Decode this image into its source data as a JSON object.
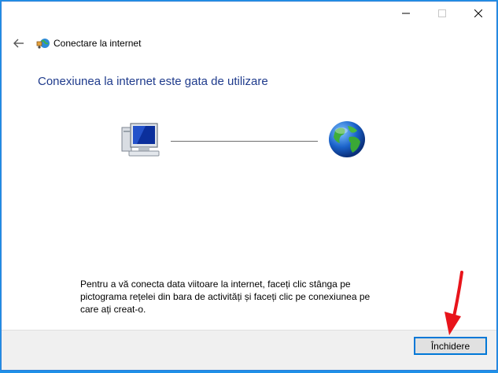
{
  "window": {
    "title_bar_buttons": {
      "minimize_icon": "minimize-icon",
      "maximize_icon": "maximize-icon",
      "close_icon": "close-icon"
    }
  },
  "nav": {
    "back_icon": "back-arrow-icon",
    "app_icon": "network-connection-icon",
    "title": "Conectare la internet"
  },
  "main": {
    "heading": "Conexiunea la internet este gata de utilizare",
    "diagram": {
      "left_icon": "computer-icon",
      "right_icon": "globe-icon"
    },
    "instructions": "Pentru a vă conecta data viitoare la internet, faceți clic stânga pe pictograma rețelei din bara de activități și faceți clic pe conexiunea pe care ați creat-o."
  },
  "footer": {
    "close_label": "Închidere"
  },
  "annotation": {
    "arrow_icon": "red-arrow-icon",
    "color": "#e8141b"
  },
  "colors": {
    "background": "#1e90e8",
    "heading": "#1f3b8c",
    "accent": "#0078d7"
  }
}
